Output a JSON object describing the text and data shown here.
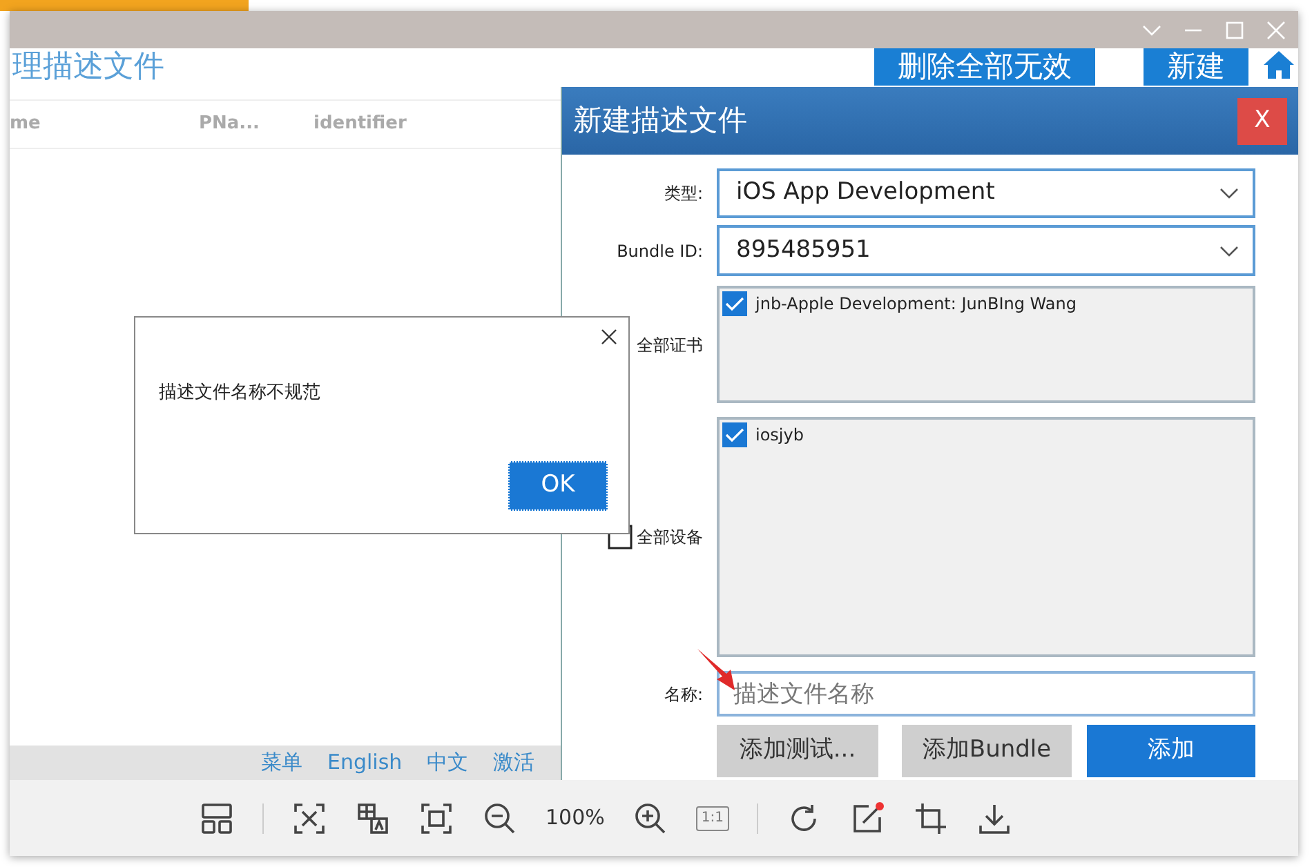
{
  "viewer": {
    "toolbar": {
      "zoom": "100%",
      "actual_size": "1:1"
    }
  },
  "app": {
    "title": "理描述文件",
    "header_buttons": [
      "删除全部无效",
      "新建"
    ],
    "columns": [
      "me",
      "PNa...",
      "identifier"
    ],
    "footer_links": [
      "菜单",
      "English",
      "中文",
      "激活"
    ]
  },
  "dialog": {
    "title": "新建描述文件",
    "close": "X",
    "fields": [
      {
        "kind": "select",
        "label": "类型:",
        "value": "iOS App Development"
      },
      {
        "kind": "select",
        "label": "Bundle ID:",
        "value": "895485951"
      }
    ],
    "certificates": {
      "label": "全部证书",
      "items": [
        {
          "label": "jnb-Apple Development: JunBIng Wang",
          "checked": true
        }
      ]
    },
    "devices": {
      "label": "全部设备",
      "checked": false,
      "items": [
        {
          "label": "iosjyb",
          "checked": true
        }
      ]
    },
    "name": {
      "label": "名称:",
      "placeholder": "描述文件名称"
    },
    "buttons": [
      {
        "label": "添加测试...",
        "primary": false
      },
      {
        "label": "添加Bundle",
        "primary": false
      },
      {
        "label": "添加",
        "primary": true
      }
    ]
  },
  "alert": {
    "message": "描述文件名称不规范",
    "button": "OK"
  }
}
